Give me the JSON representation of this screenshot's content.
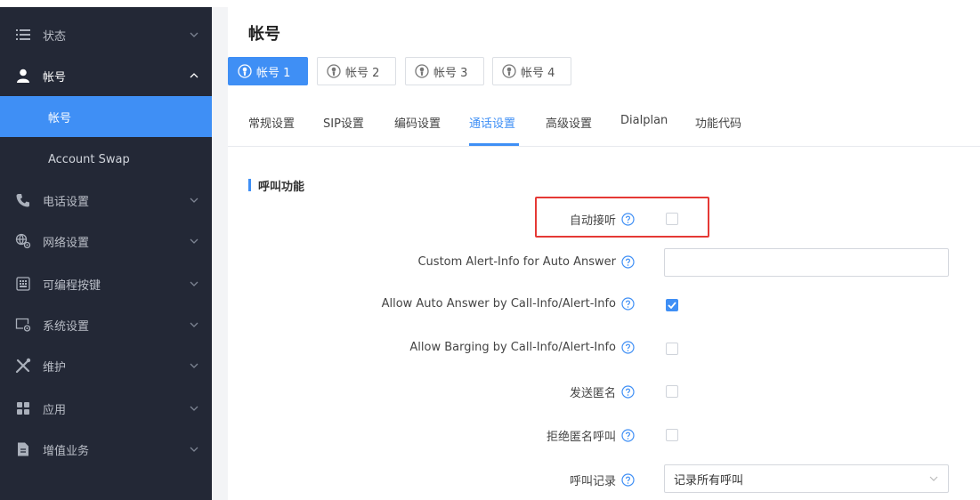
{
  "sidebar": {
    "items": [
      {
        "label": "状态",
        "icon": "list-icon"
      },
      {
        "label": "帐号",
        "icon": "person-icon"
      },
      {
        "label": "帐号"
      },
      {
        "label": "Account Swap"
      },
      {
        "label": "电话设置",
        "icon": "phone-icon"
      },
      {
        "label": "网络设置",
        "icon": "network-icon"
      },
      {
        "label": "可编程按键",
        "icon": "keypad-icon"
      },
      {
        "label": "系统设置",
        "icon": "system-settings-icon"
      },
      {
        "label": "维护",
        "icon": "tools-icon"
      },
      {
        "label": "应用",
        "icon": "apps-icon"
      },
      {
        "label": "增值业务",
        "icon": "document-icon"
      }
    ]
  },
  "header": {
    "title": "帐号"
  },
  "account_tabs": [
    {
      "label": "帐号 1",
      "active": true
    },
    {
      "label": "帐号 2",
      "active": false
    },
    {
      "label": "帐号 3",
      "active": false
    },
    {
      "label": "帐号 4",
      "active": false
    }
  ],
  "sub_tabs": [
    {
      "label": "常规设置"
    },
    {
      "label": "SIP设置"
    },
    {
      "label": "编码设置"
    },
    {
      "label": "通话设置",
      "active": true
    },
    {
      "label": "高级设置"
    },
    {
      "label": "Dialplan"
    },
    {
      "label": "功能代码"
    }
  ],
  "section": {
    "title": "呼叫功能"
  },
  "fields": {
    "auto_answer": {
      "label": "自动接听",
      "checked": false
    },
    "custom_alert_info": {
      "label": "Custom Alert-Info for Auto Answer",
      "value": ""
    },
    "allow_auto_answer_call_info": {
      "label": "Allow Auto Answer by Call-Info/Alert-Info",
      "checked": true
    },
    "allow_barging": {
      "label": "Allow Barging by Call-Info/Alert-Info",
      "checked": false
    },
    "send_anonymous": {
      "label": "发送匿名",
      "checked": false
    },
    "reject_anonymous": {
      "label": "拒绝匿名呼叫",
      "checked": false
    },
    "call_log": {
      "label": "呼叫记录",
      "value": "记录所有呼叫"
    }
  },
  "colors": {
    "accent": "#3f8ff5",
    "sidebar_bg": "#232836",
    "highlight": "#e53935"
  }
}
